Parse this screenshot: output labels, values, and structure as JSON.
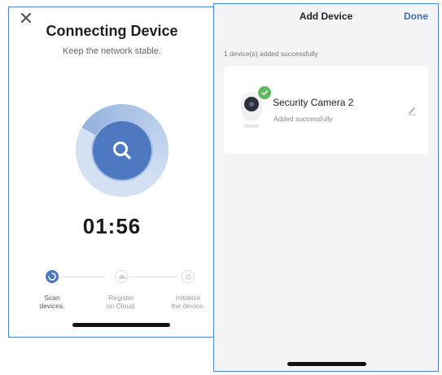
{
  "left_screen": {
    "close_icon": "close-icon",
    "title": "Connecting Device",
    "subtitle": "Keep the network stable.",
    "scan_icon": "search-icon",
    "timer": "01:56",
    "steps": [
      {
        "label_line1": "Scan",
        "label_line2": "devices.",
        "state": "active"
      },
      {
        "label_line1": "Register",
        "label_line2": "on Cloud.",
        "state": "inactive"
      },
      {
        "label_line1": "Initialize",
        "label_line2": "the device.",
        "state": "inactive"
      }
    ]
  },
  "right_screen": {
    "title": "Add Device",
    "done_label": "Done",
    "added_count": "1 device(s) added successfully",
    "device": {
      "name": "Security Camera 2",
      "status": "Added successfully",
      "icon": "security-camera-icon",
      "badge_icon": "check-icon",
      "edit_icon": "pencil-icon"
    }
  },
  "colors": {
    "accent": "#4e79c0",
    "success": "#5cb85c",
    "link": "#3f6fb5"
  }
}
